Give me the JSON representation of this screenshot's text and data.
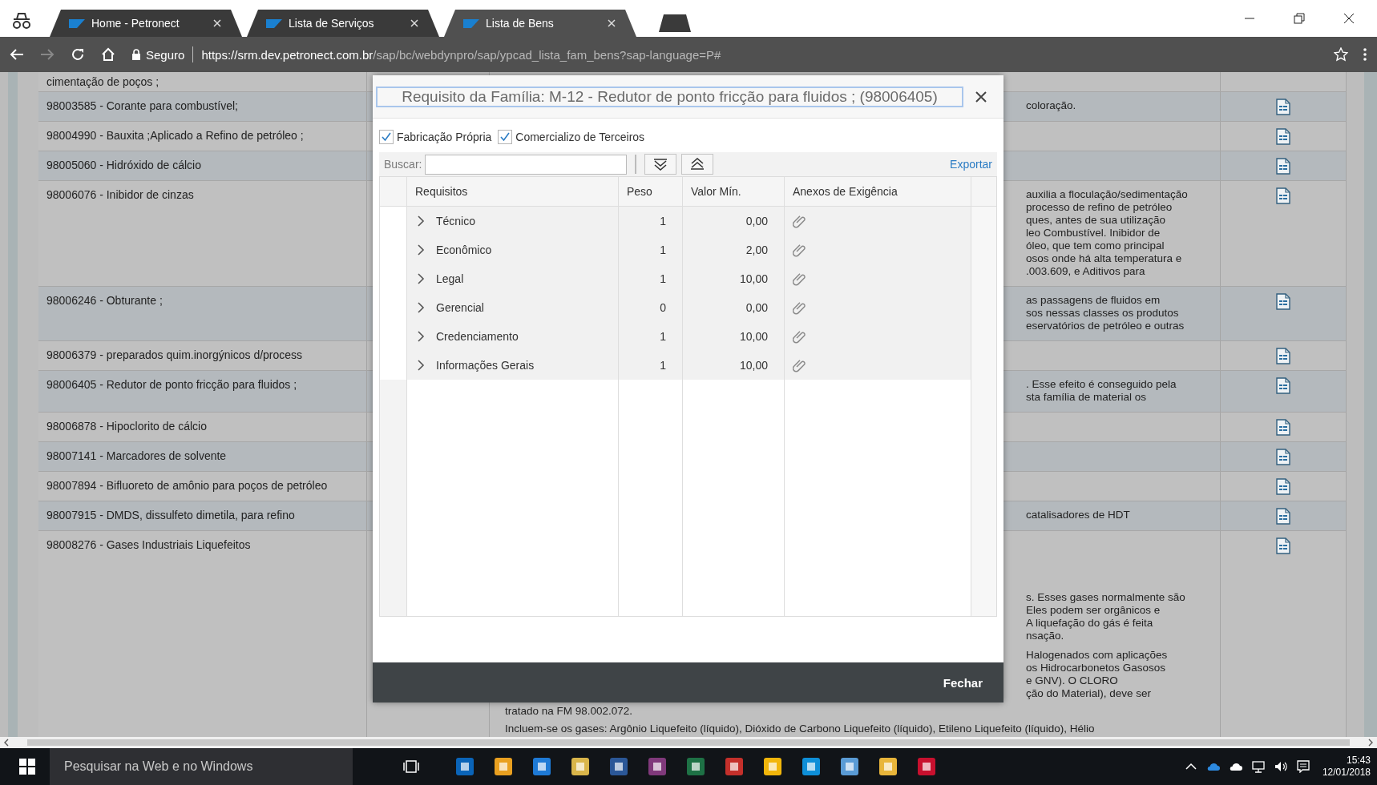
{
  "browser": {
    "tabs": [
      {
        "label": "Home - Petronect",
        "selected": false
      },
      {
        "label": "Lista de Serviços",
        "selected": false
      },
      {
        "label": "Lista de Bens",
        "selected": true
      }
    ],
    "security": "Seguro",
    "url": {
      "scheme": "https://",
      "host": "srm.dev.petronect.com.br",
      "path": "/sap/bc/webdynpro/sap/ypcad_lista_fam_bens?sap-language=P#"
    }
  },
  "list": {
    "rows": [
      {
        "kind": "continuation",
        "name": "cimentação de poços ;"
      },
      {
        "kind": "item",
        "name": "98003585 - Corante para combustível;",
        "fragments": [
          [
            "coloração."
          ]
        ]
      },
      {
        "kind": "item",
        "name": "98004990 - Bauxita ;Aplicado a Refino de petróleo ;"
      },
      {
        "kind": "item",
        "name": "98005060 - Hidróxido de cálcio"
      },
      {
        "kind": "item",
        "name": "98006076 - Inibidor de cinzas",
        "fragments": [
          [
            "auxilia a floculação/sedimentação",
            "processo de refino de petróleo",
            "ques, antes de sua utilização",
            "leo Combustível. Inibidor de",
            "óleo, que tem como principal",
            "osos onde há alta temperatura e",
            ".003.609, e Aditivos para"
          ]
        ]
      },
      {
        "kind": "item",
        "name": "98006246 - Obturante ;",
        "fragments": [
          [
            "as passagens de fluidos em",
            "sos nessas classes os produtos",
            "eservatórios de petróleo e outras"
          ]
        ]
      },
      {
        "kind": "item",
        "name": "98006379 - preparados quim.inorgýnicos d/process"
      },
      {
        "kind": "item",
        "name": "98006405 - Redutor de ponto fricção para fluidos ;",
        "fragments": [
          [
            ". Esse efeito é conseguido pela",
            "sta família de material os"
          ]
        ]
      },
      {
        "kind": "item",
        "name": "98006878 - Hipoclorito de cálcio"
      },
      {
        "kind": "item",
        "name": "98007141 - Marcadores de solvente"
      },
      {
        "kind": "item",
        "name": "98007894 - Bifluoreto de amônio para poços de petróleo"
      },
      {
        "kind": "item",
        "name": "98007915 - DMDS, dissulfeto dimetila, para refino",
        "fragments": [
          [
            "catalisadores de HDT"
          ]
        ]
      },
      {
        "kind": "item",
        "name": "98008276 - Gases Industriais Liquefeitos",
        "fragments": [
          [
            "s. Esses gases normalmente são",
            "Eles podem ser orgânicos e",
            "A liquefação do gás é feita",
            "nsação."
          ],
          [
            "Halogenados com aplicações",
            "os Hidrocarbonetos Gasosos",
            "e GNV). O CLORO",
            "ção do Material), deve ser"
          ]
        ],
        "lines": [
          [
            "tratado na FM 98.002.072."
          ],
          [
            "Incluem-se os gases: Argônio Liquefeito (líquido), Dióxido de Carbono Liquefeito (líquido), Etileno Liquefeito (líquido), Hélio"
          ]
        ]
      }
    ]
  },
  "dialog": {
    "title": "Requisito da Família: M-12 - Redutor de ponto fricção para fluidos ; (98006405)",
    "options": [
      {
        "label": "Fabricação Própria",
        "checked": true
      },
      {
        "label": "Comercializo de Terceiros",
        "checked": true
      }
    ],
    "search": {
      "label": "Buscar:"
    },
    "export": "Exportar",
    "columns": [
      "Requisitos",
      "Peso",
      "Valor Mín.",
      "Anexos de Exigência"
    ],
    "rows": [
      {
        "name": "Técnico",
        "weight": "1",
        "min": "0,00",
        "expanded": false
      },
      {
        "name": "Econômico",
        "weight": "1",
        "min": "2,00",
        "expanded": false
      },
      {
        "name": "Legal",
        "weight": "1",
        "min": "10,00",
        "expanded": false
      },
      {
        "name": "Gerencial",
        "weight": "0",
        "min": "0,00",
        "expanded": false
      },
      {
        "name": "Credenciamento",
        "weight": "1",
        "min": "10,00",
        "expanded": false
      },
      {
        "name": "Informações Gerais",
        "weight": "1",
        "min": "10,00",
        "expanded": false
      }
    ],
    "close_button": "Fechar"
  },
  "taskbar": {
    "search_placeholder": "Pesquisar na Web e no Windows",
    "time": "15:43",
    "date": "12/01/2018"
  }
}
